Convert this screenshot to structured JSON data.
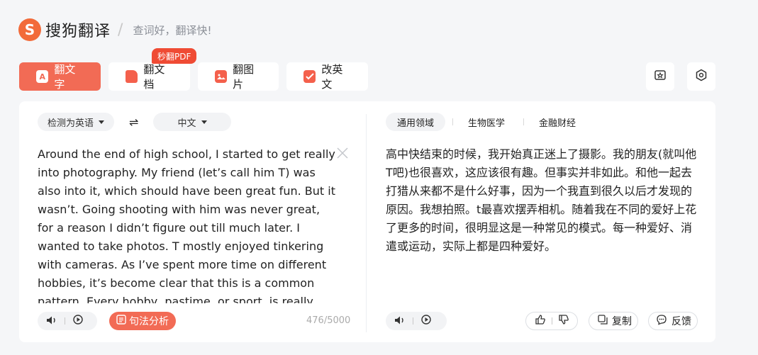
{
  "header": {
    "logo_letter": "S",
    "app_name": "搜狗翻译",
    "slogan": "查词好，翻译快!"
  },
  "tabs": [
    {
      "label": "翻文字",
      "icon": "text-translate-icon",
      "active": true
    },
    {
      "label": "翻文档",
      "icon": "document-icon",
      "active": false
    },
    {
      "label": "翻图片",
      "icon": "image-icon",
      "active": false
    },
    {
      "label": "改英文",
      "icon": "edit-check-icon",
      "active": false
    }
  ],
  "badge": {
    "label": "秒翻PDF"
  },
  "tab_icon_letter": "A",
  "top_buttons": [
    "favorites-icon",
    "settings-icon"
  ],
  "source": {
    "language": "检测为英语",
    "text": "Around the end of high school, I started to get really into photography. My friend (let’s call him T) was also into it, which should have been great fun. But it wasn’t. Going shooting with him was never great, for a reason I didn’t figure out till much later. I wanted to take photos. T mostly enjoyed tinkering with cameras. As I’ve spent more time on different hobbies, it’s become clear that this is a common pattern. Every hobby, pastime, or sport, is really",
    "char_count": "476/5000",
    "analyze_label": "句法分析"
  },
  "target": {
    "language": "中文",
    "domains": [
      "通用领域",
      "生物医学",
      "金融财经"
    ],
    "active_domain": 0,
    "text": "高中快结束的时候，我开始真正迷上了摄影。我的朋友(就叫他T吧)也很喜欢，这应该很有趣。但事实并非如此。和他一起去打猎从来都不是什么好事，因为一个我直到很久以后才发现的原因。我想拍照。t最喜欢摆弄相机。随着我在不同的爱好上花了更多的时间，很明显这是一种常见的模式。每一种爱好、消遣或运动，实际上都是四种爱好。",
    "copy_label": "复制",
    "feedback_label": "反馈"
  },
  "colors": {
    "accent": "#f26b55",
    "badge": "#ef4b34"
  }
}
